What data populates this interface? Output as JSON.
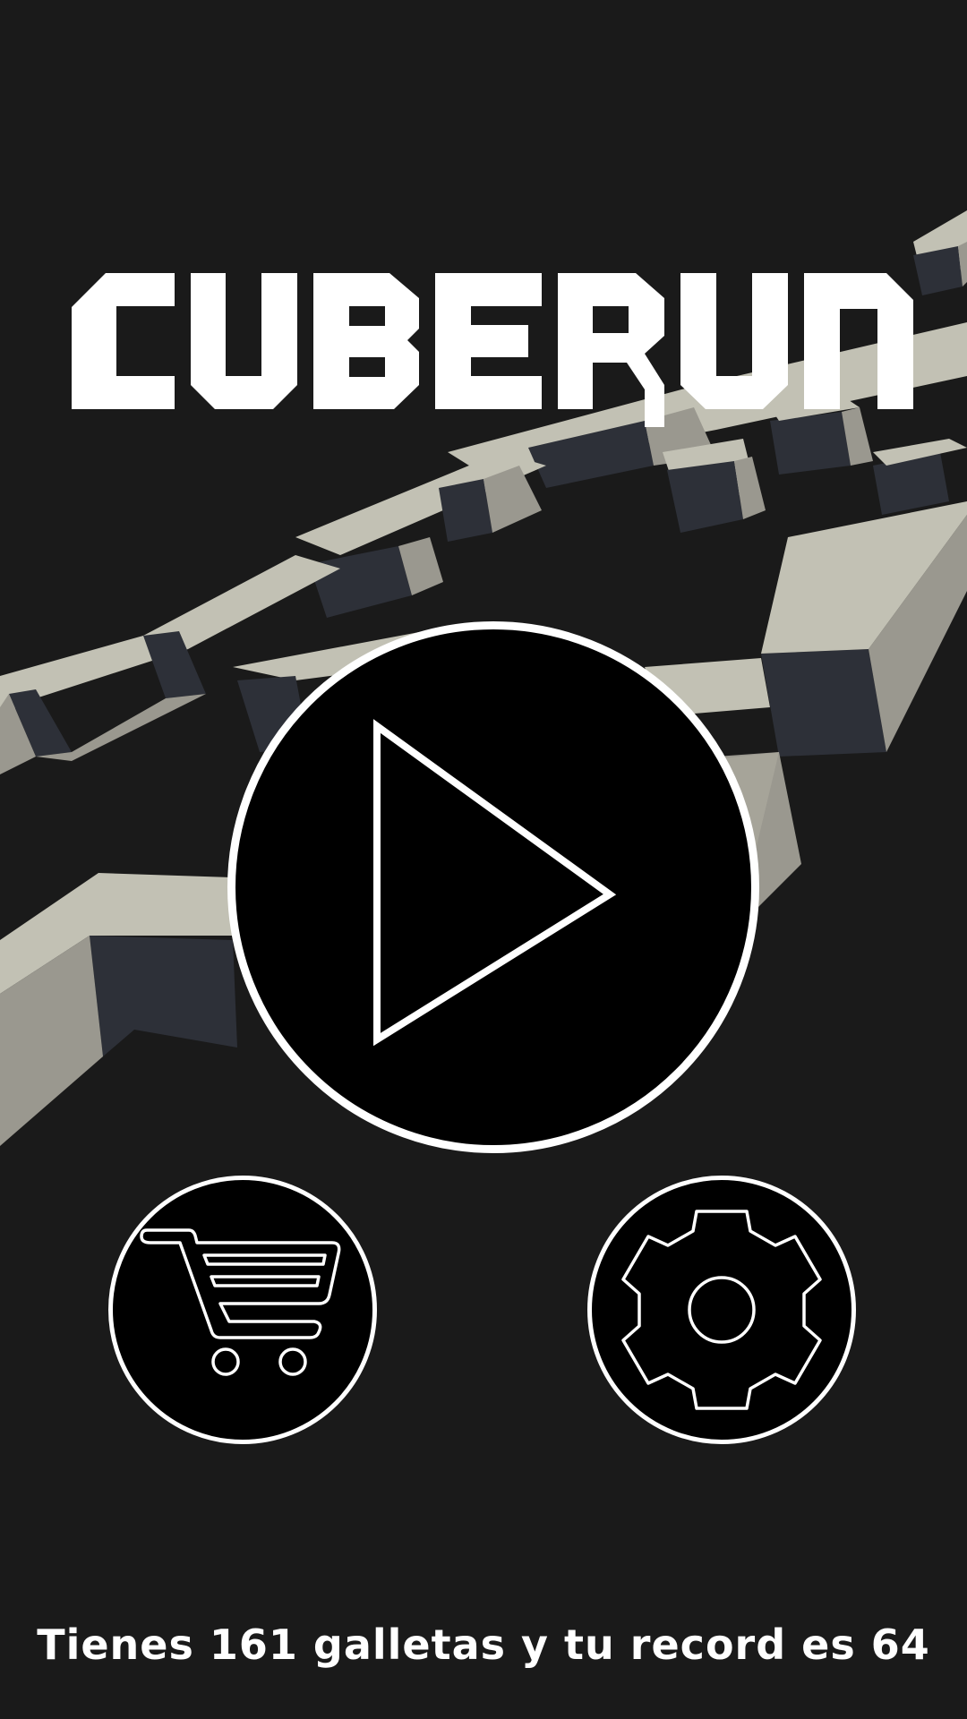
{
  "app": {
    "logo_text": "CUBERUN"
  },
  "controls": {
    "play_icon": "play-triangle-icon",
    "shop_icon": "shopping-cart-icon",
    "settings_icon": "gear-icon"
  },
  "status": {
    "message": "Tienes 161 galletas y tu record es 64"
  },
  "colors": {
    "background": "#1a1a1a",
    "cube_top": "#c2c1b4",
    "cube_side_light": "#9a988f",
    "cube_side_dark": "#2d3038",
    "button_fill": "#000000",
    "button_outline": "#ffffff"
  }
}
